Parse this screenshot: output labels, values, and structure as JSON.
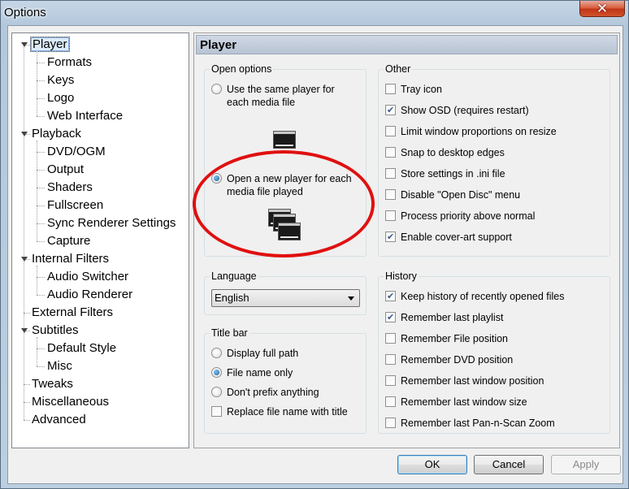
{
  "window": {
    "title": "Options",
    "close_glyph": "✕"
  },
  "tree": {
    "items": [
      {
        "label": "Player",
        "level": 0,
        "expander": true,
        "selected": true
      },
      {
        "label": "Formats",
        "level": 1
      },
      {
        "label": "Keys",
        "level": 1
      },
      {
        "label": "Logo",
        "level": 1
      },
      {
        "label": "Web Interface",
        "level": 1
      },
      {
        "label": "Playback",
        "level": 0,
        "expander": true
      },
      {
        "label": "DVD/OGM",
        "level": 1
      },
      {
        "label": "Output",
        "level": 1
      },
      {
        "label": "Shaders",
        "level": 1
      },
      {
        "label": "Fullscreen",
        "level": 1
      },
      {
        "label": "Sync Renderer Settings",
        "level": 1
      },
      {
        "label": "Capture",
        "level": 1
      },
      {
        "label": "Internal Filters",
        "level": 0,
        "expander": true
      },
      {
        "label": "Audio Switcher",
        "level": 1
      },
      {
        "label": "Audio Renderer",
        "level": 1
      },
      {
        "label": "External Filters",
        "level": 0
      },
      {
        "label": "Subtitles",
        "level": 0,
        "expander": true
      },
      {
        "label": "Default Style",
        "level": 1
      },
      {
        "label": "Misc",
        "level": 1
      },
      {
        "label": "Tweaks",
        "level": 0
      },
      {
        "label": "Miscellaneous",
        "level": 0
      },
      {
        "label": "Advanced",
        "level": 0
      }
    ]
  },
  "page": {
    "header": "Player",
    "open_options": {
      "title": "Open options",
      "same_player": {
        "label_line1": "Use the same player for",
        "label_line2": "each media file",
        "checked": false
      },
      "new_player": {
        "label_line1": "Open a new player for each",
        "label_line2": "media file played",
        "checked": true
      },
      "highlight_color": "#e01010"
    },
    "language": {
      "title": "Language",
      "value": "English"
    },
    "title_bar": {
      "title": "Title bar",
      "options": [
        {
          "label": "Display full path",
          "checked": false
        },
        {
          "label": "File name only",
          "checked": true
        },
        {
          "label": "Don't prefix anything",
          "checked": false
        }
      ],
      "replace_file_name": {
        "label": "Replace file name with title",
        "checked": false
      }
    },
    "other": {
      "title": "Other",
      "items": [
        {
          "label": "Tray icon",
          "checked": false
        },
        {
          "label": "Show OSD (requires restart)",
          "checked": true
        },
        {
          "label": "Limit window proportions on resize",
          "checked": false
        },
        {
          "label": "Snap to desktop edges",
          "checked": false
        },
        {
          "label": "Store settings in .ini file",
          "checked": false
        },
        {
          "label": "Disable \"Open Disc\" menu",
          "checked": false
        },
        {
          "label": "Process priority above normal",
          "checked": false
        },
        {
          "label": "Enable cover-art support",
          "checked": true
        }
      ]
    },
    "history": {
      "title": "History",
      "items": [
        {
          "label": "Keep history of recently opened files",
          "checked": true
        },
        {
          "label": "Remember last playlist",
          "checked": true
        },
        {
          "label": "Remember File position",
          "checked": false
        },
        {
          "label": "Remember DVD position",
          "checked": false
        },
        {
          "label": "Remember last window position",
          "checked": false
        },
        {
          "label": "Remember last window size",
          "checked": false
        },
        {
          "label": "Remember last Pan-n-Scan Zoom",
          "checked": false
        }
      ]
    }
  },
  "buttons": {
    "ok": "OK",
    "cancel": "Cancel",
    "apply": "Apply"
  }
}
